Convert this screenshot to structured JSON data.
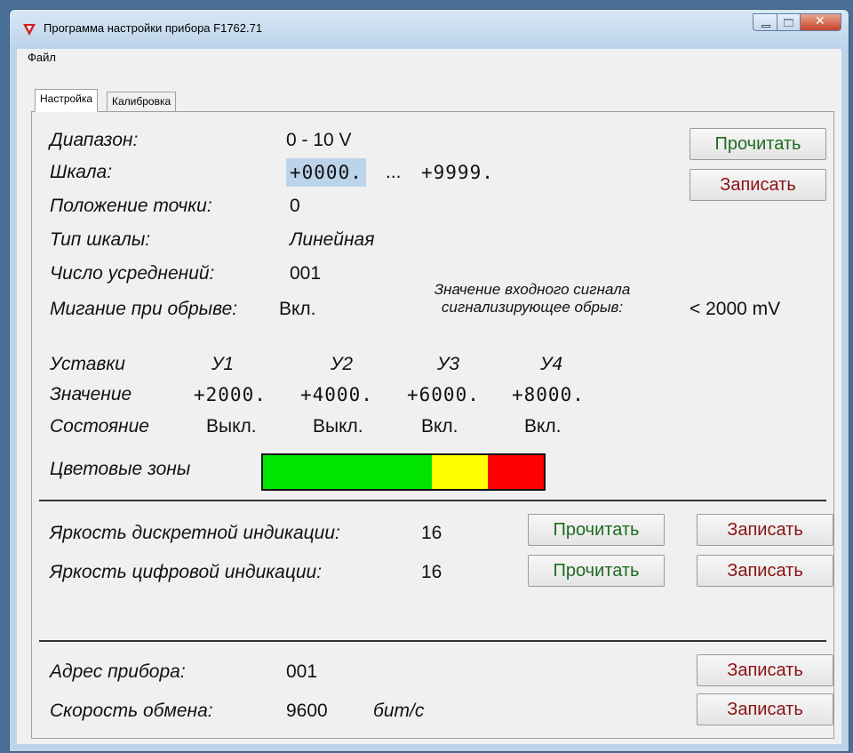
{
  "window": {
    "title": "Программа настройки прибора F1762.71"
  },
  "menu": {
    "file": "Файл"
  },
  "tabs": [
    {
      "label": "Настройка"
    },
    {
      "label": "Калибровка"
    }
  ],
  "settings": {
    "range_label": "Диапазон:",
    "range_value": "0 - 10 V",
    "scale_label": "Шкала:",
    "scale_from": "+0000.",
    "scale_sep": "...",
    "scale_to": "+9999.",
    "point_label": "Положение точки:",
    "point_value": "0",
    "scale_type_label": "Тип шкалы:",
    "scale_type_value": "Линейная",
    "avg_label": "Число усреднений:",
    "avg_value": "001",
    "blink_label": "Мигание при обрыве:",
    "blink_value": "Вкл.",
    "break_signal_line1": "Значение входного сигнала",
    "break_signal_line2": "сигнализирующее обрыв:",
    "break_signal_value": "< 2000 mV",
    "read_button": "Прочитать",
    "write_button": "Записать"
  },
  "setpoints": {
    "header_label": "Уставки",
    "value_label": "Значение",
    "state_label": "Состояние",
    "items": [
      {
        "name": "У1",
        "value": "+2000.",
        "state": "Выкл."
      },
      {
        "name": "У2",
        "value": "+4000.",
        "state": "Выкл."
      },
      {
        "name": "У3",
        "value": "+6000.",
        "state": "Вкл."
      },
      {
        "name": "У4",
        "value": "+8000.",
        "state": "Вкл."
      }
    ]
  },
  "color_zones": {
    "label": "Цветовые зоны",
    "zones": [
      {
        "color": "#00e600",
        "fraction": 0.6
      },
      {
        "color": "#ffff00",
        "fraction": 0.2
      },
      {
        "color": "#ff0000",
        "fraction": 0.2
      }
    ]
  },
  "brightness": {
    "discrete_label": "Яркость дискретной индикации:",
    "discrete_value": "16",
    "digital_label": "Яркость цифровой индикации:",
    "digital_value": "16",
    "read_button": "Прочитать",
    "write_button": "Записать"
  },
  "comm": {
    "address_label": "Адрес прибора:",
    "address_value": "001",
    "speed_label": "Скорость обмена:",
    "speed_value": "9600",
    "speed_unit": "бит/с",
    "write_button": "Записать"
  },
  "colors": {
    "read_text": "#1e6b1e",
    "write_text": "#8b1212",
    "selection": "#bcd4ea"
  }
}
